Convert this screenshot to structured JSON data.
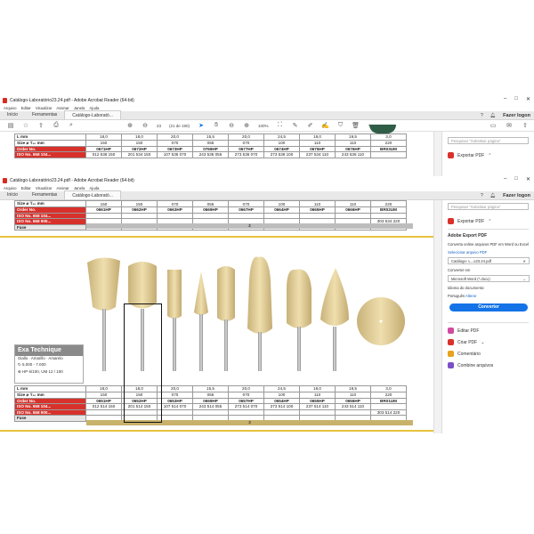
{
  "window1": {
    "title": "Catálogo-Laboratório23.24.pdf - Adobe Acrobat Reader (64-bit)",
    "menu": [
      "Arquivo",
      "Editar",
      "Visualizar",
      "Assinar",
      "Janela",
      "Ajuda"
    ],
    "tabs": {
      "home": "Início",
      "tools": "Ferramentas",
      "doc": "Catálogo-Laborató...",
      "signin": "Fazer logon"
    },
    "page_num": "23",
    "page_total": "(21 de 190)",
    "zoom": "100%",
    "search_placeholder": "Pesquisar \"Substituir página\"",
    "export_label": "Exportar PDF",
    "table": {
      "rows": [
        [
          "L mm",
          "18,0",
          "18,0",
          "20,0",
          "15,5",
          "20,0",
          "24,5",
          "18,0",
          "19,5",
          "3,0"
        ],
        [
          "Size ⌀ ¹/₁₀ mm",
          "150",
          "150",
          "070",
          "055",
          "070",
          "100",
          "110",
          "110",
          "220"
        ],
        [
          "Order No.",
          "0671HP",
          "0672HP",
          "0673HP",
          "0769HP",
          "0677HP",
          "0674HP",
          "0675HP",
          "0676HP",
          "BR03UM"
        ],
        [
          "ISO No. 658 104...",
          "012 536 150",
          "201 534 150",
          "107 536 070",
          "243 536 055",
          "273 536 070",
          "273 536 100",
          "237 534 110",
          "243 536 110",
          ""
        ]
      ]
    }
  },
  "window2": {
    "title": "Catálogo-Laboratório23.24.pdf - Adobe Acrobat Reader (64-bit)",
    "menu": [
      "Arquivo",
      "Editar",
      "Visualizar",
      "Assinar",
      "Janela",
      "Ajuda"
    ],
    "tabs": {
      "home": "Início",
      "tools": "Ferramentas",
      "doc": "Catálogo-Laborató...",
      "signin": "Fazer logon"
    },
    "top_table": {
      "rows": [
        [
          "Size ⌀ ¹/₁₀ mm",
          "150",
          "150",
          "070",
          "055",
          "070",
          "100",
          "110",
          "110",
          "220"
        ],
        [
          "Order No.",
          "0661HP",
          "0662HP",
          "0663HP",
          "0669HP",
          "0667HP",
          "0664HP",
          "0665HP",
          "0666HP",
          "BR02UM"
        ],
        [
          "ISO No. 658 104...",
          "",
          "",
          "",
          "",
          "",
          "",
          "",
          "",
          ""
        ],
        [
          "ISO No. 658 900...",
          "",
          "",
          "",
          "",
          "",
          "",
          "",
          "",
          "303 534 220"
        ],
        [
          "Fase",
          "",
          "",
          "",
          "",
          "",
          "",
          "",
          "",
          ""
        ]
      ],
      "fase_label": "2"
    },
    "product": {
      "name": "Exa Technique",
      "colors": "Giallo · Amarillo · Amarelo",
      "speed": "5.000 - 7.000",
      "shank": "HP 6/100, UM 12 / 100"
    },
    "bottom_table": {
      "rows": [
        [
          "L mm",
          "18,0",
          "18,0",
          "20,0",
          "15,5",
          "20,0",
          "24,5",
          "18,0",
          "19,5",
          "3,0"
        ],
        [
          "Size ⌀ ¹/₁₀ mm",
          "150",
          "150",
          "070",
          "055",
          "070",
          "100",
          "110",
          "110",
          "220"
        ],
        [
          "Order No.",
          "0651HP",
          "0652HP",
          "0653HP",
          "0659HP",
          "0657HP",
          "0654HP",
          "0655HP",
          "0656HP",
          "BR01UM"
        ],
        [
          "ISO No. 658 104...",
          "012 514 150",
          "201 514 150",
          "107 514 070",
          "243 514 055",
          "273 514 070",
          "273 514 100",
          "237 514 110",
          "243 514 110",
          ""
        ],
        [
          "ISO No. 658 900...",
          "",
          "",
          "",
          "",
          "",
          "",
          "",
          "",
          "303 514 220"
        ],
        [
          "Fase",
          "",
          "",
          "",
          "",
          "",
          "",
          "",
          "",
          ""
        ]
      ],
      "fase_label": "3"
    },
    "sidebar": {
      "search_placeholder": "Pesquisar \"Substituir página\"",
      "export_label": "Exportar PDF",
      "panel_title": "Adobe Export PDF",
      "panel_desc": "Converta online arquivos PDF em Word ou Excel",
      "select_link": "Selecionar arquivo PDF",
      "file_name": "Catálogo- L...o23.24.pdf",
      "convert_label": "Converter em",
      "convert_value": "Microsoft Word (*.docx)",
      "lang_label": "Idioma do documento:",
      "lang_value": "Português",
      "lang_change": "Alterar",
      "convert_button": "Converter",
      "tools": [
        {
          "label": "Editar PDF",
          "color": "#d14aa0"
        },
        {
          "label": "Criar PDF",
          "color": "#d9312b"
        },
        {
          "label": "Comentário",
          "color": "#e8a21c"
        },
        {
          "label": "Combine arquivos",
          "color": "#7b4fc8"
        }
      ]
    }
  }
}
